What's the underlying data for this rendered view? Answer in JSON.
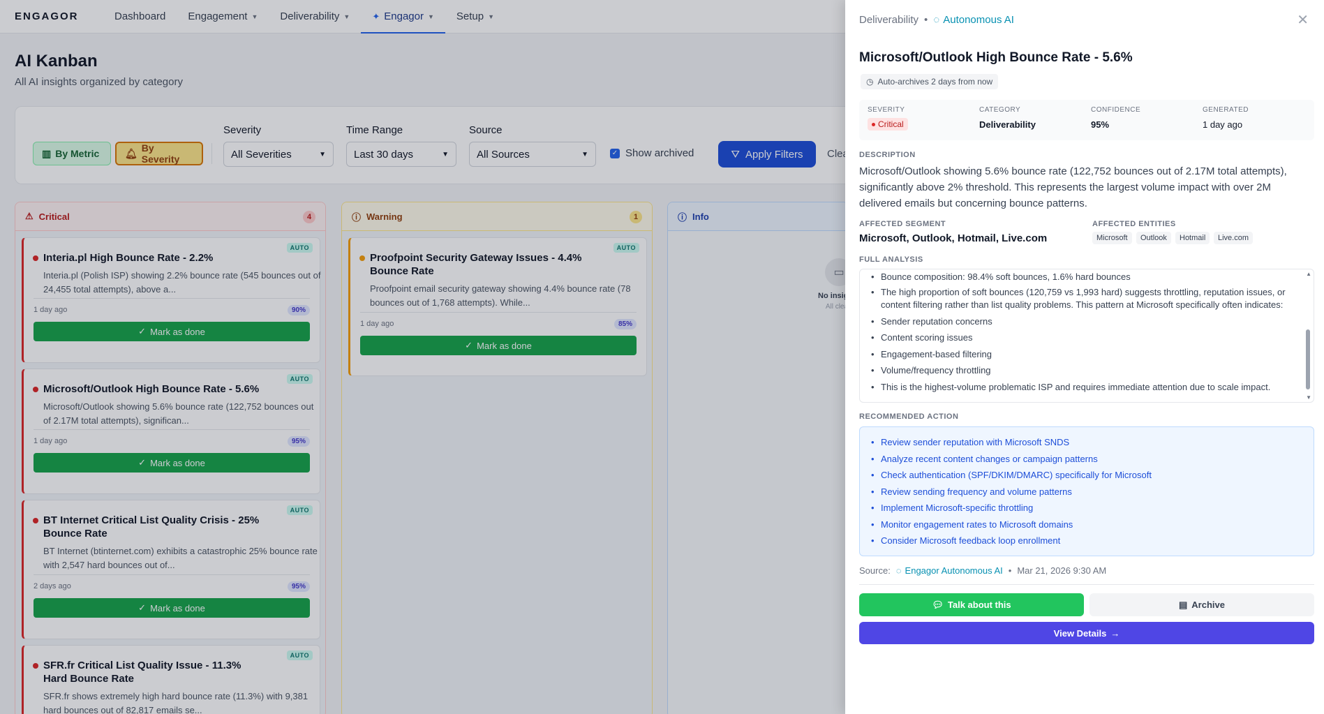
{
  "nav": {
    "logo": "ENGAGOR",
    "items": [
      {
        "label": "Dashboard"
      },
      {
        "label": "Engagement"
      },
      {
        "label": "Deliverability"
      },
      {
        "label": "Engagor"
      },
      {
        "label": "Setup"
      }
    ]
  },
  "page": {
    "title": "AI Kanban",
    "subtitle": "All AI insights organized by category"
  },
  "filters": {
    "by_metric": "By Metric",
    "by_severity": "By Severity",
    "severity_label": "Severity",
    "severity_value": "All Severities",
    "time_label": "Time Range",
    "time_value": "Last 30 days",
    "source_label": "Source",
    "source_value": "All Sources",
    "show_archived": "Show archived",
    "show_archived_checked": true,
    "apply": "Apply Filters",
    "clear": "Clear fi"
  },
  "columns": {
    "critical": {
      "label": "Critical",
      "count": "4",
      "cards": [
        {
          "title": "Interia.pl High Bounce Rate - 2.2%",
          "desc": "Interia.pl (Polish ISP) showing 2.2% bounce rate (545 bounces out of 24,455 total attempts), above a...",
          "age": "1 day ago",
          "confidence": "90%",
          "badge": "AUTO",
          "action": "Mark as done"
        },
        {
          "title": "Microsoft/Outlook High Bounce Rate - 5.6%",
          "desc": "Microsoft/Outlook showing 5.6% bounce rate (122,752 bounces out of 2.17M total attempts), significan...",
          "age": "1 day ago",
          "confidence": "95%",
          "badge": "AUTO",
          "action": "Mark as done"
        },
        {
          "title": "BT Internet Critical List Quality Crisis - 25% Bounce Rate",
          "desc": "BT Internet (btinternet.com) exhibits a catastrophic 25% bounce rate with 2,547 hard bounces out of...",
          "age": "2 days ago",
          "confidence": "95%",
          "badge": "AUTO",
          "action": "Mark as done"
        },
        {
          "title": "SFR.fr Critical List Quality Issue - 11.3% Hard Bounce Rate",
          "desc": "SFR.fr shows extremely high hard bounce rate (11.3%) with 9,381 hard bounces out of 82,817 emails se...",
          "badge": "AUTO"
        }
      ]
    },
    "warning": {
      "label": "Warning",
      "count": "1",
      "cards": [
        {
          "title": "Proofpoint Security Gateway Issues - 4.4% Bounce Rate",
          "desc": "Proofpoint email security gateway showing 4.4% bounce rate (78 bounces out of 1,768 attempts). While...",
          "age": "1 day ago",
          "confidence": "85%",
          "badge": "AUTO",
          "action": "Mark as done"
        }
      ]
    },
    "info": {
      "label": "Info",
      "empty_title": "No insights",
      "empty_sub": "All clear!"
    }
  },
  "panel": {
    "crumb": "Deliverability",
    "crumb_ai": "Autonomous AI",
    "title": "Microsoft/Outlook High Bounce Rate - 5.6%",
    "auto_archive": "Auto-archives  2 days from now",
    "meta": {
      "severity_label": "SEVERITY",
      "severity_value": "Critical",
      "category_label": "CATEGORY",
      "category_value": "Deliverability",
      "confidence_label": "CONFIDENCE",
      "confidence_value": "95%",
      "generated_label": "GENERATED",
      "generated_value": "1 day ago"
    },
    "description_label": "DESCRIPTION",
    "description": "Microsoft/Outlook showing 5.6% bounce rate (122,752 bounces out of 2.17M total attempts), significantly above 2% threshold. This represents the largest volume impact with over 2M delivered emails but concerning bounce patterns.",
    "segment_label": "AFFECTED SEGMENT",
    "segment_value": "Microsoft, Outlook, Hotmail, Live.com",
    "entities_label": "AFFECTED ENTITIES",
    "entities": [
      "Microsoft",
      "Outlook",
      "Hotmail",
      "Live.com"
    ],
    "analysis_label": "FULL ANALYSIS",
    "analysis": [
      "Bounce composition: 98.4% soft bounces, 1.6% hard bounces",
      "The high proportion of soft bounces (120,759 vs 1,993 hard) suggests throttling, reputation issues, or content filtering rather than list quality problems. This pattern at Microsoft specifically often indicates:",
      "Sender reputation concerns",
      "Content scoring issues",
      "Engagement-based filtering",
      "Volume/frequency throttling",
      "This is the highest-volume problematic ISP and requires immediate attention due to scale impact."
    ],
    "recs_label": "RECOMMENDED ACTION",
    "recs": [
      "Review sender reputation with Microsoft SNDS",
      "Analyze recent content changes or campaign patterns",
      "Check authentication (SPF/DKIM/DMARC) specifically for Microsoft",
      "Review sending frequency and volume patterns",
      "Implement Microsoft-specific throttling",
      "Monitor engagement rates to Microsoft domains",
      "Consider Microsoft feedback loop enrollment"
    ],
    "source_label": "Source:",
    "source_value": "Engagor Autonomous AI",
    "source_date": "Mar 21, 2026 9:30 AM",
    "talk": "Talk about this",
    "archive": "Archive",
    "view_details": "View Details"
  }
}
